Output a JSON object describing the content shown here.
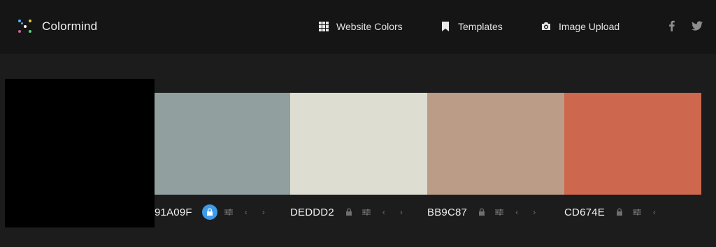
{
  "app": {
    "name": "Colormind",
    "logo_dot_colors": [
      "#4fb4e8",
      "#e7c93c",
      "#d75a8d",
      "#5fcf7a",
      "#8e8ee0",
      "#ffffff"
    ]
  },
  "nav": {
    "items": [
      {
        "label": "Website Colors",
        "icon": "grid-icon"
      },
      {
        "label": "Templates",
        "icon": "bookmark-icon"
      },
      {
        "label": "Image Upload",
        "icon": "camera-icon"
      }
    ],
    "social": [
      "facebook-icon",
      "twitter-icon"
    ]
  },
  "palette": {
    "colors": [
      {
        "hex": "91A09F",
        "color": "#91A09F",
        "locked": true
      },
      {
        "hex": "DEDDD2",
        "color": "#DEDDD2",
        "locked": false
      },
      {
        "hex": "BB9C87",
        "color": "#BB9C87",
        "locked": false
      },
      {
        "hex": "CD674E",
        "color": "#CD674E",
        "locked": false
      }
    ]
  },
  "colors": {
    "topbar_bg": "#151515",
    "page_bg": "#1c1c1c",
    "lock_accent": "#3d9be9",
    "control_gray": "#6f6f6f"
  }
}
